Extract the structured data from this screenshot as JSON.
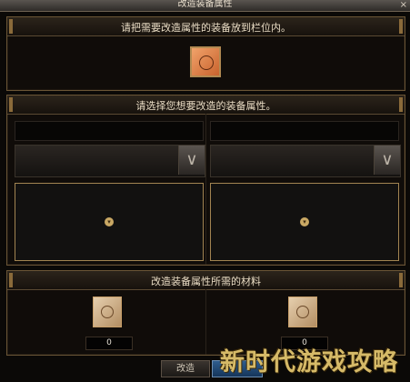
{
  "window": {
    "title": "改造装备属性",
    "close_glyph": "×"
  },
  "section1": {
    "header": "请把需要改造属性的装备放到栏位内。",
    "slot_icon": "rune-slot-icon"
  },
  "section2": {
    "header": "请选择您想要改造的装备属性。",
    "dropdown_glyph": "∨",
    "expand_glyph": "▾"
  },
  "section3": {
    "header": "改造装备属性所需的材料",
    "left_count": "0",
    "right_count": "0",
    "material_icon": "rune-slot-icon"
  },
  "buttons": {
    "modify": "改造",
    "confirm": ""
  },
  "watermark": "新时代游戏攻略",
  "colors": {
    "gold_border": "#a28451",
    "slot_orange": "#c9632e",
    "button_blue": "#2f5d8e"
  }
}
